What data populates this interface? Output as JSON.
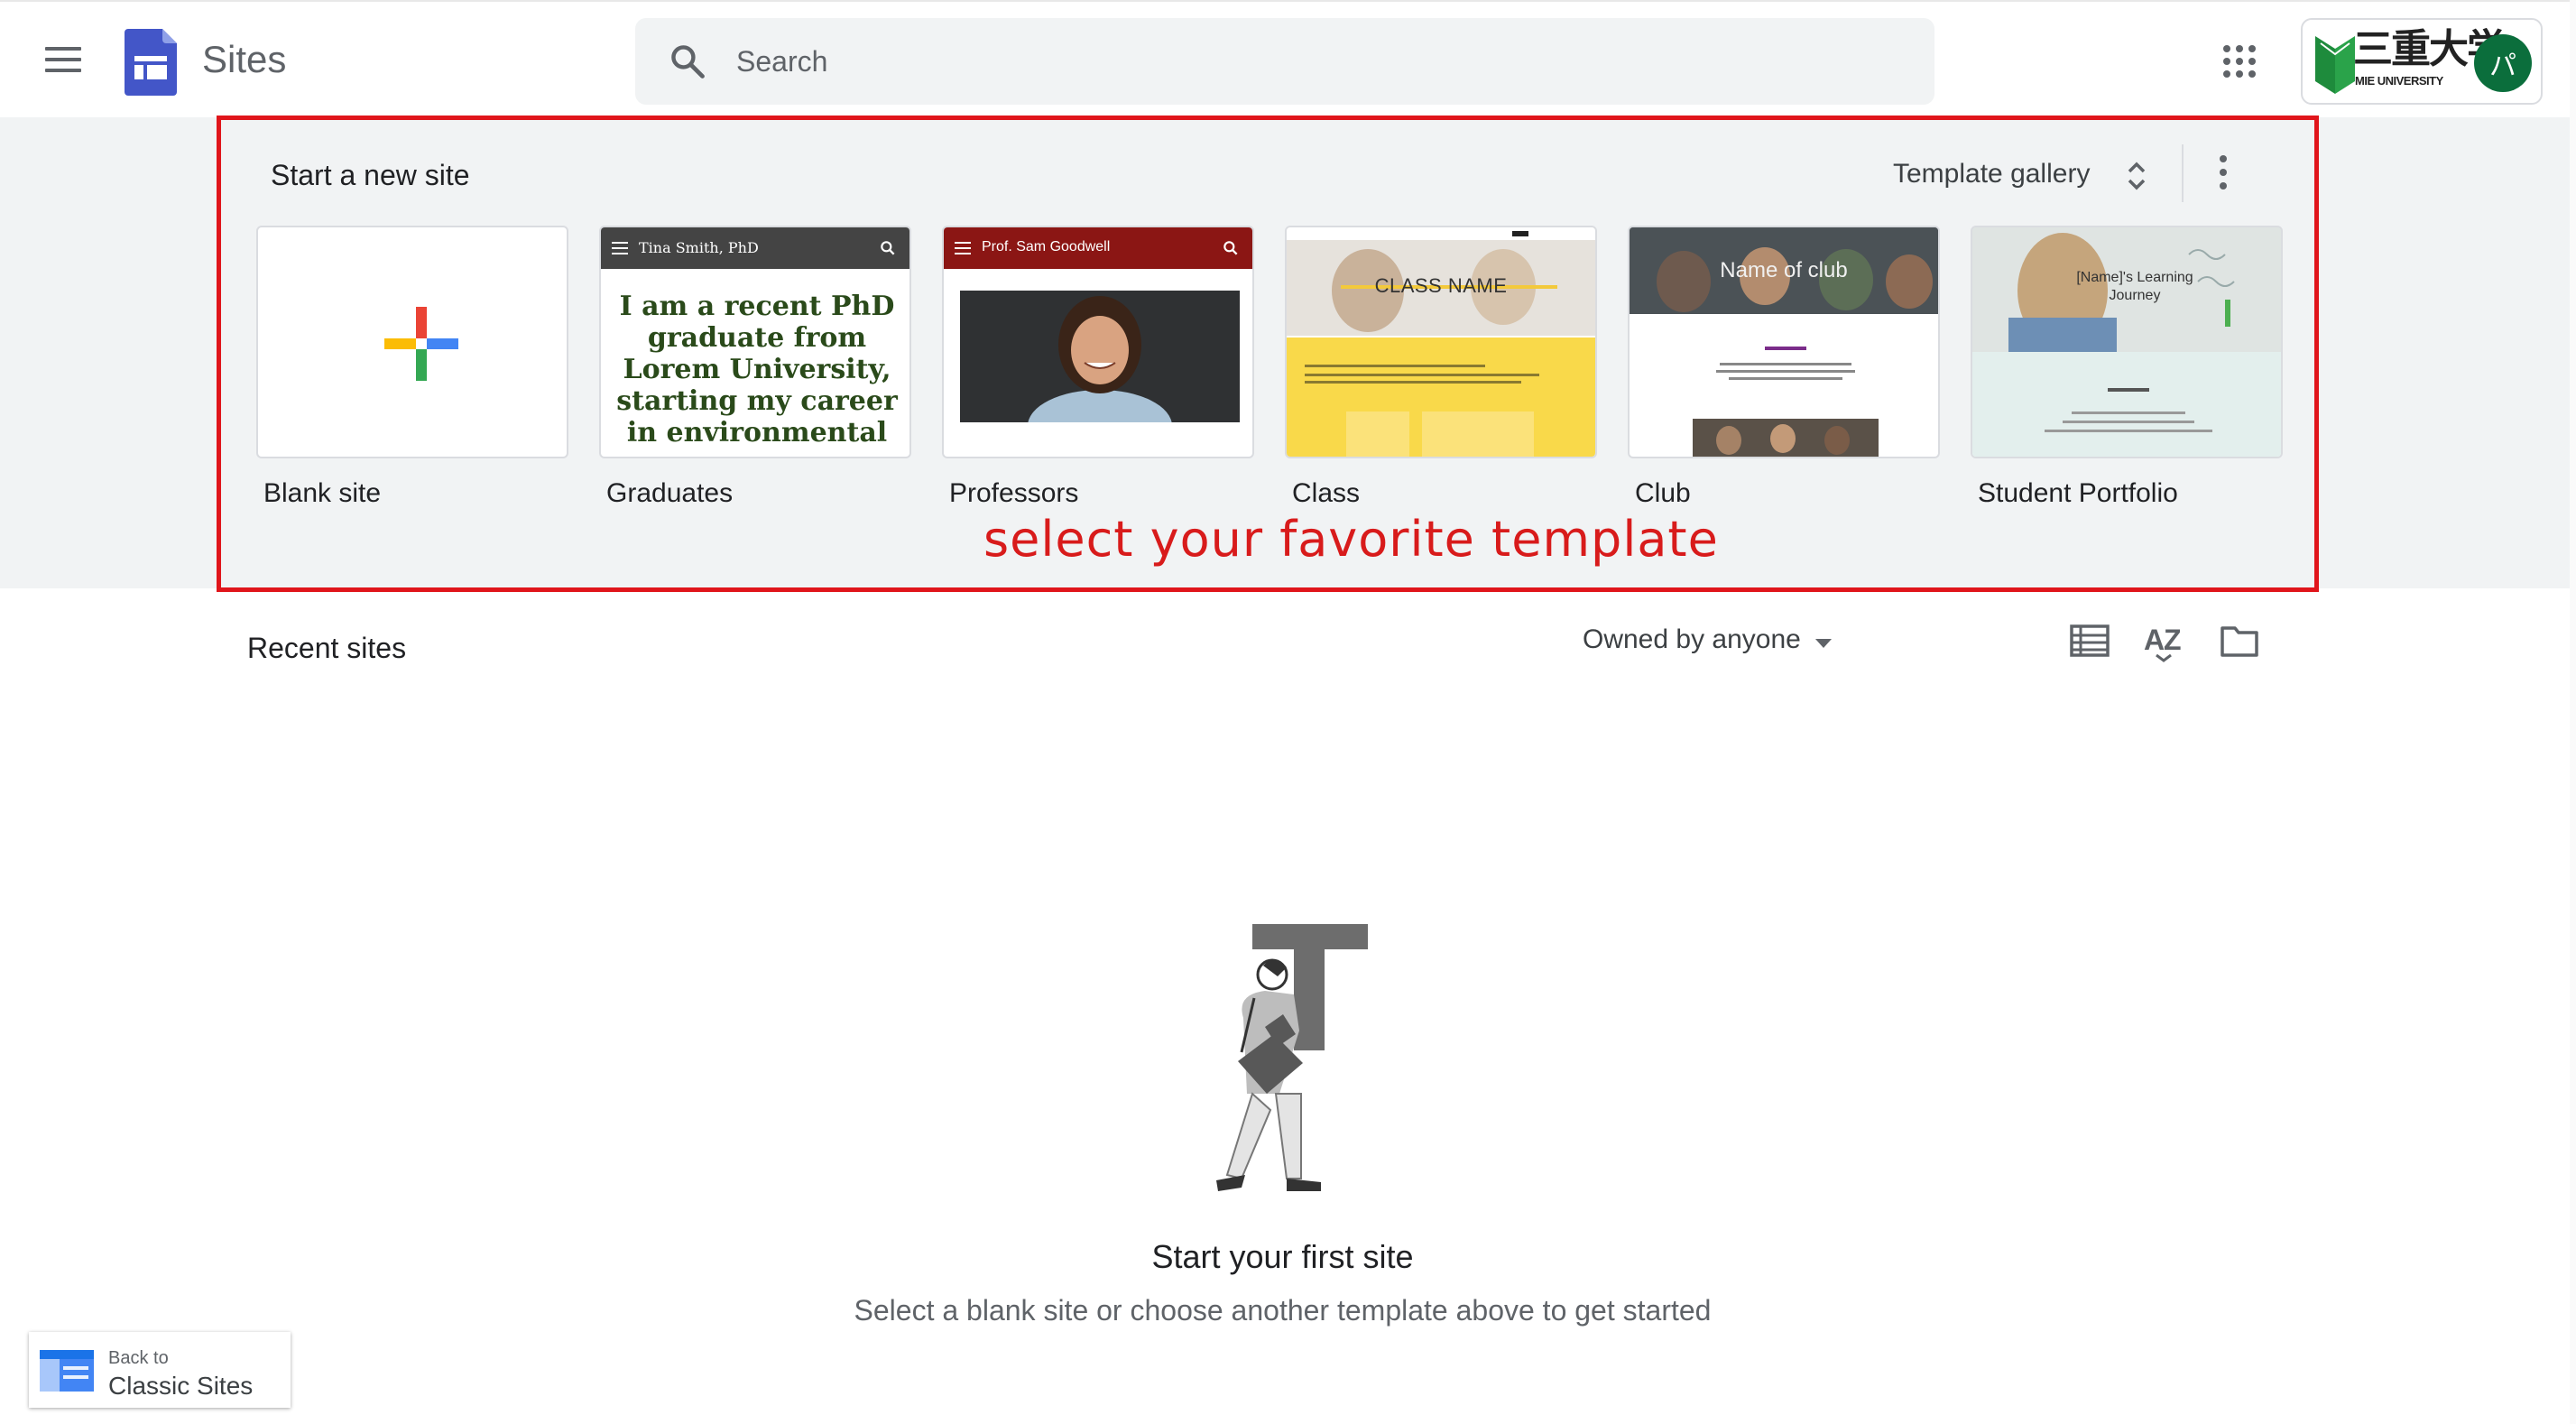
{
  "header": {
    "menu_icon": "hamburger-menu-icon",
    "app_logo_icon": "google-sites-logo-icon",
    "app_name": "Sites",
    "search": {
      "placeholder": "Search",
      "icon": "search-icon"
    },
    "apps_icon": "google-apps-grid-icon",
    "organization": {
      "kanji": "三重大学",
      "name": "MIE UNIVERSITY",
      "logo_icon": "mie-university-logo-icon"
    },
    "avatar_initial": "パ",
    "avatar_color": "#0b6e3c"
  },
  "templates": {
    "section_title": "Start a new site",
    "gallery_label": "Template gallery",
    "gallery_icon": "unfold-more-icon",
    "more_icon": "more-vert-icon",
    "items": [
      {
        "label": "Blank site",
        "icon": "colorful-plus-icon"
      },
      {
        "label": "Graduates",
        "header": "Tina Smith, PhD",
        "body": "I am a recent PhD graduate from Lorem University, starting my career in environmental"
      },
      {
        "label": "Professors",
        "header": "Prof. Sam Goodwell"
      },
      {
        "label": "Class",
        "heading": "CLASS NAME"
      },
      {
        "label": "Club",
        "heading": "Name of club"
      },
      {
        "label": "Student Portfolio",
        "heading": "[Name]'s Learning Journey"
      }
    ],
    "callout": "select your favorite template",
    "callout_color": "#e0151b"
  },
  "recent": {
    "title": "Recent sites",
    "owner_filter": "Owned by anyone",
    "list_view_icon": "list-view-icon",
    "sort_icon": "sort-az-icon",
    "folder_icon": "folder-icon"
  },
  "empty_state": {
    "illustration": "person-carrying-letter-t-illustration",
    "title": "Start your first site",
    "subtitle": "Select a blank site or choose another template above to get started"
  },
  "classic": {
    "small_label": "Back to",
    "label": "Classic Sites",
    "icon": "classic-sites-icon"
  },
  "colors": {
    "sites_brand": "#4356c8",
    "band_background": "#f1f3f4",
    "professors_red": "#8b1614",
    "class_yellow": "#f9d94a"
  }
}
